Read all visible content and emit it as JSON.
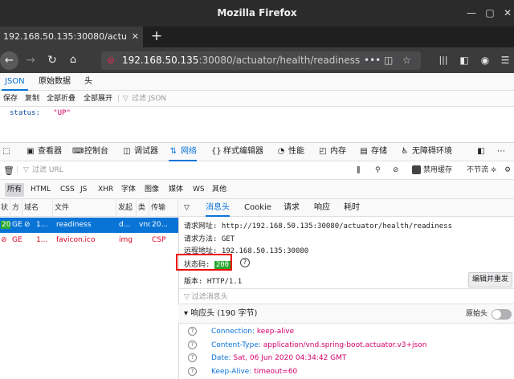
{
  "window": {
    "title": "Mozilla Firefox"
  },
  "tab": {
    "title": "192.168.50.135:30080/actu",
    "close": "✕",
    "new_tab": "+"
  },
  "url": {
    "host": "192.168.50.135",
    "rest": ":30080/actuator/health/readiness"
  },
  "json_viewer": {
    "tabs": [
      "JSON",
      "原始数据",
      "头"
    ],
    "toolbar": [
      "保存",
      "复制",
      "全部折叠",
      "全部展开"
    ],
    "filter_placeholder": "过滤 JSON",
    "key": "status:",
    "value": "\"UP\""
  },
  "devtools": {
    "tabs": [
      "查看器",
      "控制台",
      "调试器",
      "网络",
      "样式编辑器",
      "性能",
      "内存",
      "存储",
      "无障碍环境"
    ],
    "filter_placeholder": "过滤 URL",
    "disable_cache": "禁用缓存",
    "throttle": "不节流 ≑",
    "type_filters": [
      "所有",
      "HTML",
      "CSS",
      "JS",
      "XHR",
      "字体",
      "图像",
      "媒体",
      "WS",
      "其他"
    ],
    "columns": [
      "状",
      "方",
      "域名",
      "文件",
      "发起",
      "类",
      "传输"
    ],
    "requests": [
      {
        "status": "20",
        "method": "GE",
        "domain": "1...",
        "file": "readiness",
        "initiator": "d...",
        "type": "vnd",
        "transfer": "20..."
      },
      {
        "status": "",
        "method": "GE",
        "domain": "1...",
        "file": "favicon.ico",
        "initiator": "img",
        "type": "CSP",
        "transfer": ""
      }
    ],
    "detail_tabs": [
      "消息头",
      "Cookie",
      "请求",
      "响应",
      "耗时"
    ],
    "request_url": "请求网址: http://192.168.50.135:30080/actuator/health/readiness",
    "request_method": "请求方法: GET",
    "remote_address": "远程地址: 192.168.50.135:30080",
    "status_label": "状态码:",
    "status_code": "200",
    "version": "版本: HTTP/1.1",
    "edit_resend": "编辑并重发",
    "filter_headers": "过滤消息头",
    "response_headers_title": "响应头 (190 字节)",
    "raw_headers": "原始头",
    "response_headers": [
      {
        "name": "Connection:",
        "value": "keep-alive"
      },
      {
        "name": "Content-Type:",
        "value": "application/vnd.spring-boot.actuator.v3+json"
      },
      {
        "name": "Date:",
        "value": "Sat, 06 Jun 2020 04:34:42 GMT"
      },
      {
        "name": "Keep-Alive:",
        "value": "timeout=60"
      }
    ]
  }
}
